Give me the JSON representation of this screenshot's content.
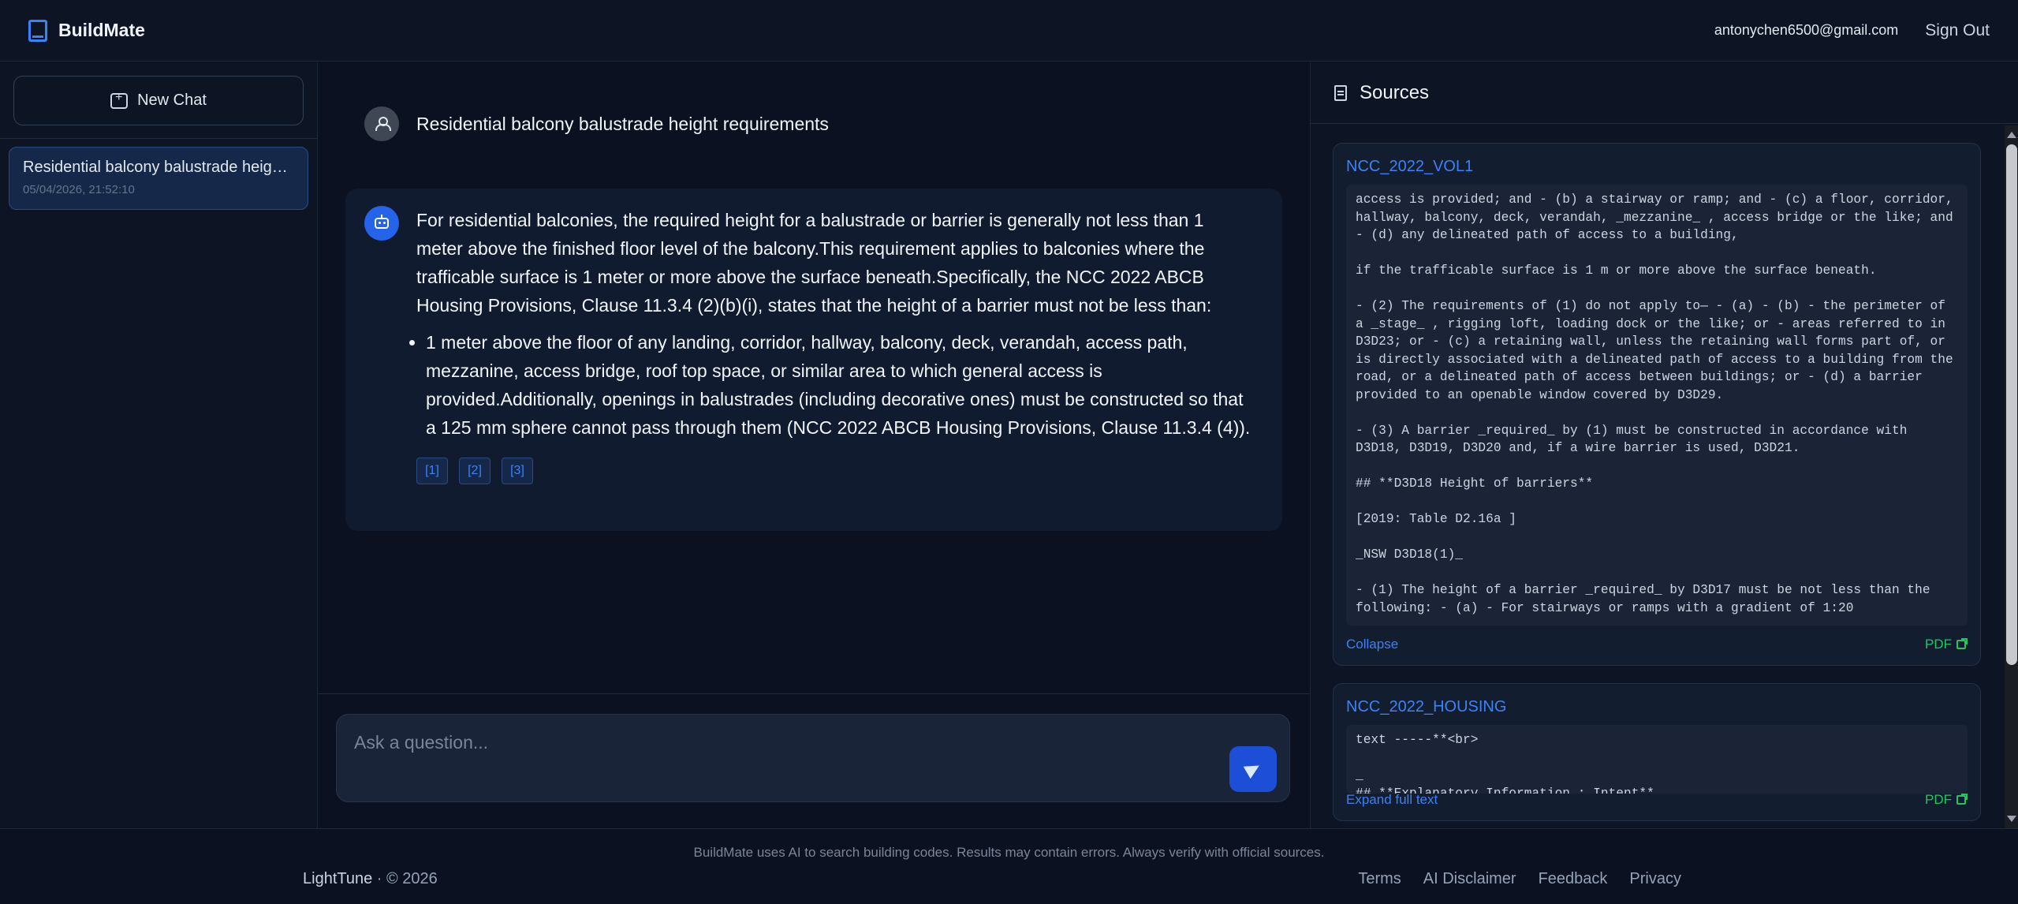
{
  "app": {
    "name": "BuildMate",
    "user_email": "antonychen6500@gmail.com",
    "sign_out_label": "Sign Out"
  },
  "sidebar": {
    "new_chat_label": "New Chat",
    "history": [
      {
        "title": "Residential balcony balustrade height requirements",
        "timestamp": "05/04/2026, 21:52:10"
      }
    ]
  },
  "chat": {
    "user_message": "Residential balcony balustrade height requirements",
    "assistant_paragraph": "For residential balconies, the required height for a balustrade or barrier is generally not less than 1 meter above the finished floor level of the balcony.This requirement applies to balconies where the trafficable surface is 1 meter or more above the surface beneath.Specifically, the NCC 2022 ABCB Housing Provisions, Clause 11.3.4 (2)(b)(i), states that the height of a barrier must not be less than:",
    "assistant_bullets": [
      "1 meter above the floor of any landing, corridor, hallway, balcony, deck, verandah, access path, mezzanine, access bridge, roof top space, or similar area to which general access is provided.Additionally, openings in balustrades (including decorative ones) must be constructed so that a 125 mm sphere cannot pass through them (NCC 2022 ABCB Housing Provisions, Clause 11.3.4 (4))."
    ],
    "citations": [
      "[1]",
      "[2]",
      "[3]"
    ],
    "input_placeholder": "Ask a question..."
  },
  "sources": {
    "title": "Sources",
    "items": [
      {
        "name": "NCC_2022_VOL1",
        "text": "access is provided; and - (b) a stairway or ramp; and - (c) a floor, corridor, hallway, balcony, deck, verandah, _mezzanine_ , access bridge or the like; and - (d) any delineated path of access to a building,\n\nif the trafficable surface is 1 m or more above the surface beneath.\n\n- (2) The requirements of (1) do not apply to— - (a) - (b) - the perimeter of a _stage_ , rigging loft, loading dock or the like; or - areas referred to in D3D23; or - (c) a retaining wall, unless the retaining wall forms part of, or is directly associated with a delineated path of access to a building from the road, or a delineated path of access between buildings; or - (d) a barrier provided to an openable window covered by D3D29.\n\n- (3) A barrier _required_ by (1) must be constructed in accordance with D3D18, D3D19, D3D20 and, if a wire barrier is used, D3D21.\n\n## **D3D18 Height of barriers**\n\n[2019: Table D2.16a ]\n\n_NSW D3D18(1)_\n\n- (1) The height of a barrier _required_ by D3D17 must be not less than the following: - (a) - For stairways or ramps with a gradient of 1:20",
        "toggle_label": "Collapse",
        "pdf_label": "PDF"
      },
      {
        "name": "NCC_2022_HOUSING",
        "text": "text -----**<br>\n\n_\n## **Explanatory Information : Intent**",
        "toggle_label": "Expand full text",
        "pdf_label": "PDF"
      }
    ]
  },
  "footer": {
    "disclaimer": "BuildMate uses AI to search building codes. Results may contain errors. Always verify with official sources.",
    "company": "LightTune",
    "copyright": " · © 2026",
    "links": [
      "Terms",
      "AI Disclaimer",
      "Feedback",
      "Privacy"
    ]
  },
  "colors": {
    "accent": "#3b82f6",
    "background": "#0b1120",
    "pdf_link": "#22c55e"
  }
}
